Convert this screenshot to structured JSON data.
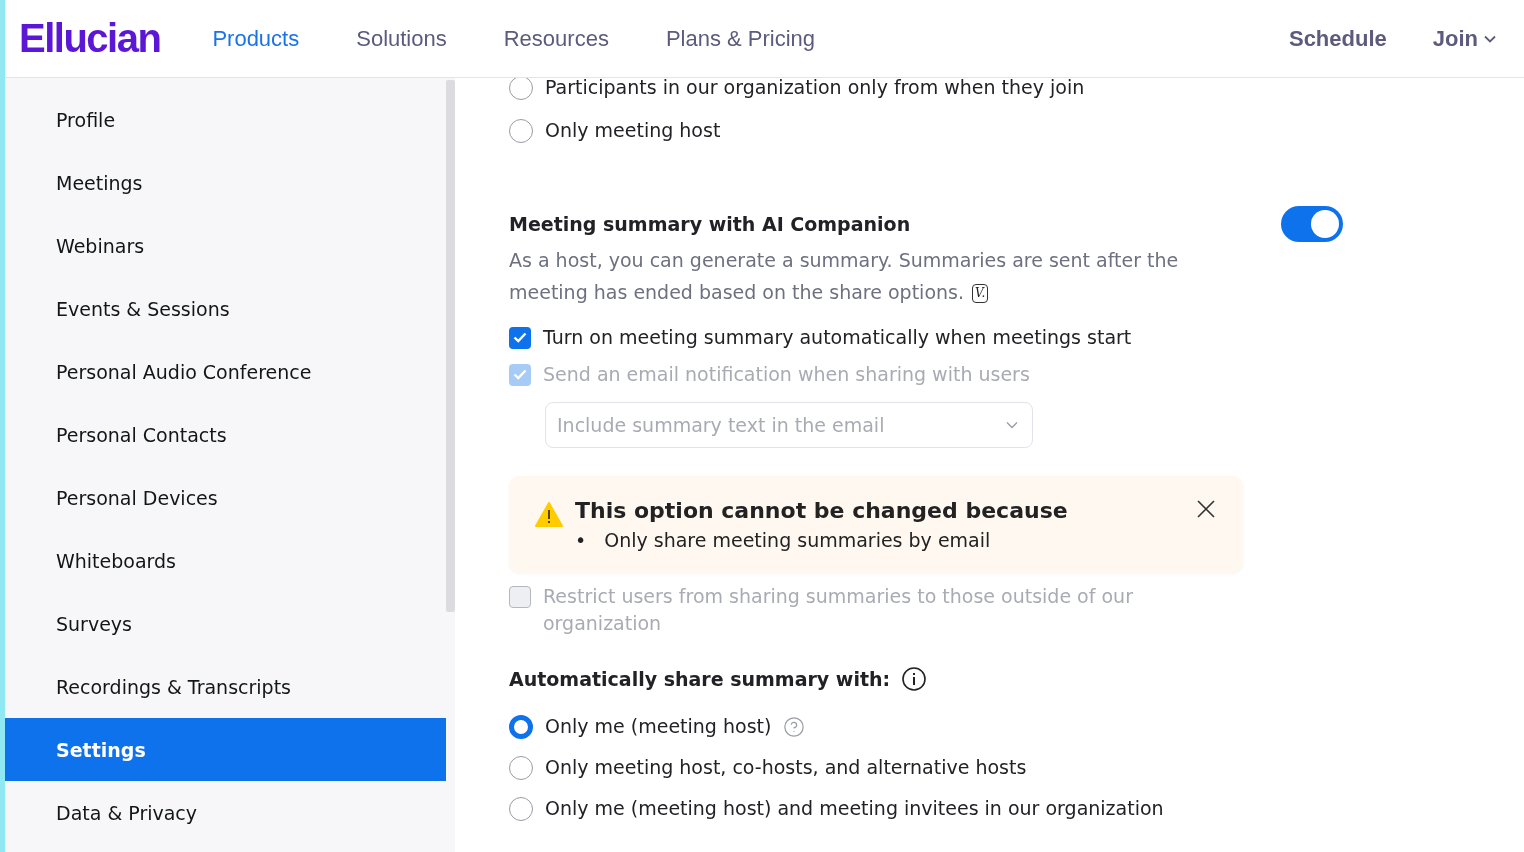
{
  "header": {
    "logo": "Ellucian",
    "nav": [
      {
        "label": "Products",
        "selected": true
      },
      {
        "label": "Solutions",
        "selected": false
      },
      {
        "label": "Resources",
        "selected": false
      },
      {
        "label": "Plans & Pricing",
        "selected": false
      }
    ],
    "actions": [
      {
        "label": "Schedule",
        "kind": "link"
      },
      {
        "label": "Join",
        "kind": "dropdown"
      }
    ]
  },
  "sidebar": {
    "items": [
      {
        "label": "Profile",
        "selected": false
      },
      {
        "label": "Meetings",
        "selected": false
      },
      {
        "label": "Webinars",
        "selected": false
      },
      {
        "label": "Events & Sessions",
        "selected": false
      },
      {
        "label": "Personal Audio Conference",
        "selected": false
      },
      {
        "label": "Personal Contacts",
        "selected": false
      },
      {
        "label": "Personal Devices",
        "selected": false
      },
      {
        "label": "Whiteboards",
        "selected": false
      },
      {
        "label": "Surveys",
        "selected": false
      },
      {
        "label": "Recordings & Transcripts",
        "selected": false
      },
      {
        "label": "Settings",
        "selected": true
      },
      {
        "label": "Data & Privacy",
        "selected": false
      }
    ]
  },
  "top_options": [
    {
      "label": "Participants in our organization only from when they join",
      "selected": false
    },
    {
      "label": "Only meeting host",
      "selected": false
    }
  ],
  "summary": {
    "title": "Meeting summary with AI Companion",
    "on": true,
    "description": "As a host, you can generate a summary. Summaries are sent after the meeting has ended based on the share options.",
    "badge": "V.",
    "checks": [
      {
        "label": "Turn on meeting summary automatically when meetings start",
        "checked": true,
        "disabled": false
      },
      {
        "label": "Send an email notification when sharing with users",
        "checked": true,
        "disabled": true
      }
    ],
    "select": {
      "value": "Include summary text in the email",
      "disabled": true
    },
    "alert": {
      "title": "This option cannot be changed because",
      "items": [
        {
          "bullet": "•",
          "text": "Only share meeting summaries by email"
        }
      ]
    },
    "restrict": {
      "label": "Restrict users from sharing summaries to those outside of our organization",
      "checked": false,
      "disabled": true
    },
    "share": {
      "title": "Automatically share summary with:",
      "options": [
        {
          "label": "Only me (meeting host)",
          "selected": true,
          "help": true
        },
        {
          "label": "Only meeting host, co-hosts, and alternative hosts",
          "selected": false,
          "help": false
        },
        {
          "label": "Only me (meeting host) and meeting invitees in our organization",
          "selected": false,
          "help": false
        }
      ]
    }
  }
}
